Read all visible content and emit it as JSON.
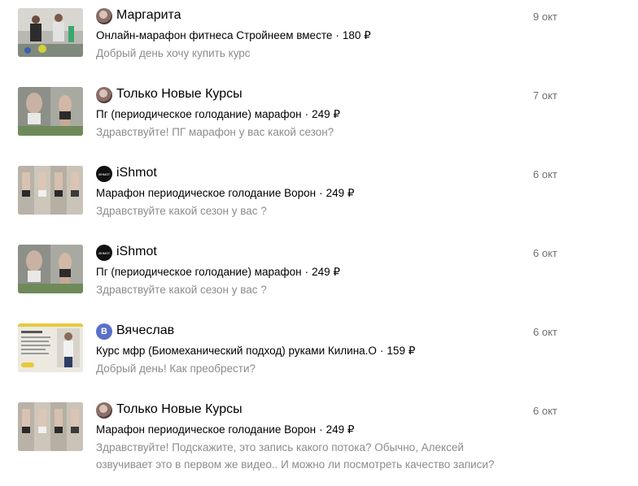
{
  "messages": [
    {
      "sender": "Маргарита",
      "avatar": "photo",
      "avatar_letter": "",
      "thumb": "fitness-group-photo",
      "date": "9 окт",
      "title": "Онлайн-марафон фитнеса Стройнеем вместе",
      "price": "180 ₽",
      "preview": "Добрый день хочу купить курс"
    },
    {
      "sender": "Только Новые Курсы",
      "avatar": "photo",
      "avatar_letter": "",
      "thumb": "before-after-photo",
      "date": "7 окт",
      "title": "Пг (периодическое голодание) марафон",
      "price": "249 ₽",
      "preview": "Здравствуйте! ПГ марафон у вас какой сезон?"
    },
    {
      "sender": "iShmot",
      "avatar": "brand",
      "avatar_letter": "iSHMOT",
      "thumb": "body-photos-row",
      "date": "6 окт",
      "title": "Марафон периодическое голодание Ворон",
      "price": "249 ₽",
      "preview": "Здравствуйте какой сезон у вас ?"
    },
    {
      "sender": "iShmot",
      "avatar": "brand",
      "avatar_letter": "iSHMOT",
      "thumb": "before-after-photo",
      "date": "6 окт",
      "title": "Пг (периодическое голодание) марафон",
      "price": "249 ₽",
      "preview": "Здравствуйте какой сезон у вас ?"
    },
    {
      "sender": "Вячеслав",
      "avatar": "letter",
      "avatar_letter": "В",
      "thumb": "course-slide",
      "date": "6 окт",
      "title": "Курс мфр (Биомеханический подход) руками Килина.О",
      "price": "159 ₽",
      "preview": "Добрый день! Как преобрести?"
    },
    {
      "sender": "Только Новые Курсы",
      "avatar": "photo",
      "avatar_letter": "",
      "thumb": "body-photos-row",
      "date": "6 окт",
      "title": "Марафон периодическое голодание Ворон",
      "price": "249 ₽",
      "preview": "Здравствуйте! Подскажите, это запись какого потока? Обычно, Алексей озвучивает это в первом же видео.. И можно ли посмотреть качество записи?"
    }
  ],
  "colors": {
    "sender": "#000000",
    "date": "#707070",
    "preview": "#8c8c8c",
    "letter_avatar": "#5a6fc7"
  }
}
